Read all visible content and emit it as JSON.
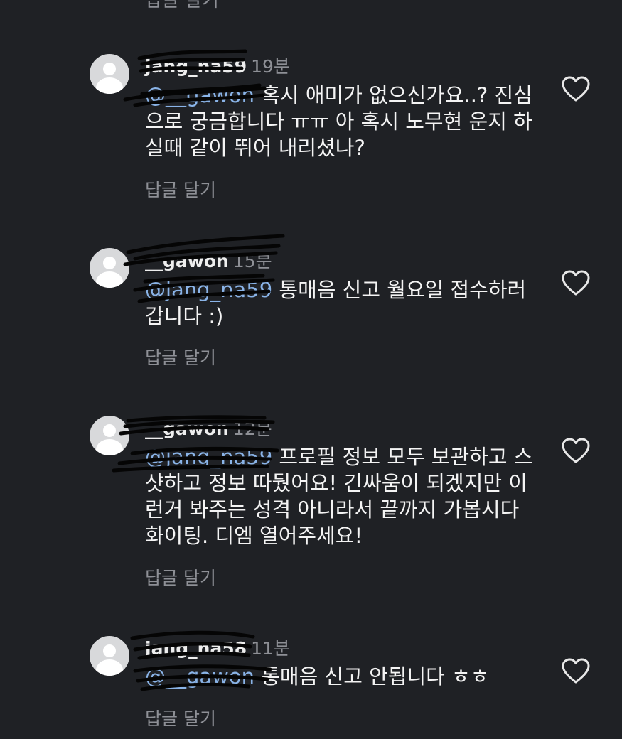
{
  "reply_label": "답글 달기",
  "comments": [
    {
      "username": "jang_na59",
      "time": "19분",
      "mention": "@__gawon",
      "text": "혹시 애미가 없으신가요..? 진심으로 궁금합니다 ㅠㅠ 아 혹시 노무현 운지 하실때 같이 뛰어 내리셨나?"
    },
    {
      "username": "__gawon",
      "time": "15분",
      "mention": "@jang_na59",
      "text": "통매음 신고 월요일 접수하러 갑니다 :)"
    },
    {
      "username": "__gawon",
      "time": "12분",
      "mention": "@jang_na59",
      "text": "프로필 정보 모두 보관하고 스샷하고 정보 따뒀어요! 긴싸움이 되겠지만 이런거 봐주는 성격 아니라서 끝까지 가봅시다 화이팅. 디엠 열어주세요!"
    },
    {
      "username": "jang_na58",
      "time": "11분",
      "mention": "@__gawon",
      "text": "통매음 신고 안됩니다 ㅎㅎ"
    }
  ],
  "icons": {
    "avatar": "default-avatar-icon",
    "like": "heart-outline-icon",
    "redaction": "scribble-redaction"
  }
}
